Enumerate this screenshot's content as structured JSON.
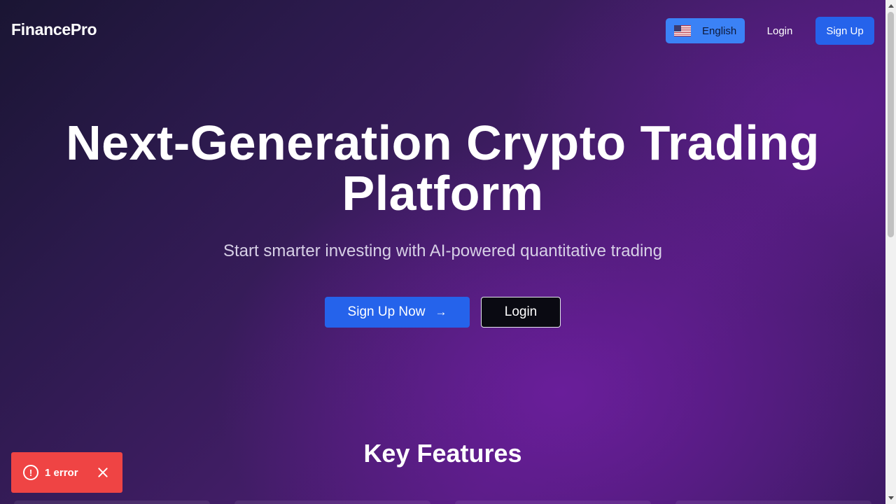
{
  "header": {
    "brand": "FinancePro",
    "language": {
      "label": "English",
      "flag_icon": "us-flag-icon"
    },
    "login_label": "Login",
    "signup_label": "Sign Up"
  },
  "hero": {
    "title_line1": "Next-Generation Crypto Trading",
    "title_line2": "Platform",
    "subtitle": "Start smarter investing with AI-powered quantitative trading",
    "primary_cta": "Sign Up Now",
    "primary_cta_icon": "arrow-right-icon",
    "secondary_cta": "Login"
  },
  "features": {
    "title": "Key Features"
  },
  "toast": {
    "label": "1 error",
    "icon": "error-circle-icon",
    "close_icon": "close-icon"
  },
  "colors": {
    "accent": "#2563eb",
    "language_button": "#3b82f6",
    "error": "#ef4444",
    "background_start": "#1a1533",
    "background_end": "#4f1c78"
  }
}
